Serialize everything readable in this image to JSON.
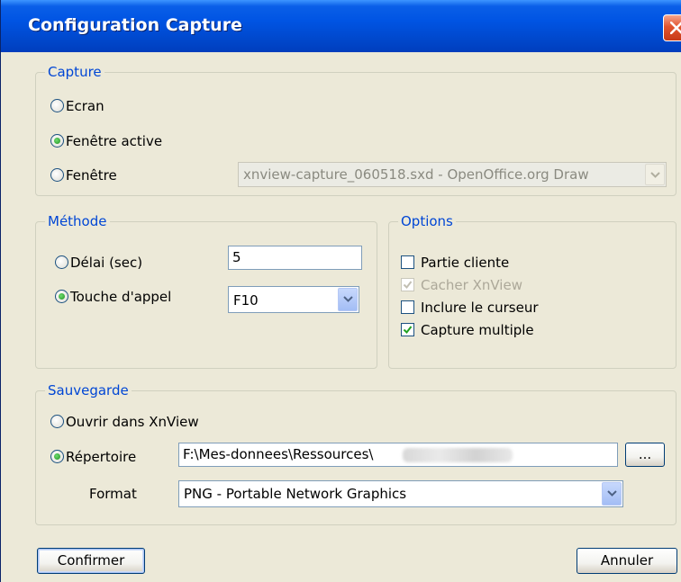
{
  "window": {
    "title": "Configuration Capture"
  },
  "capture": {
    "title": "Capture",
    "options": [
      {
        "label": "Ecran",
        "checked": false
      },
      {
        "label": "Fenêtre active",
        "checked": true
      },
      {
        "label": "Fenêtre",
        "checked": false
      }
    ],
    "window_select": {
      "value": "xnview-capture_060518.sxd - OpenOffice.org Draw",
      "disabled": true
    }
  },
  "methode": {
    "title": "Méthode",
    "delay": {
      "label": "Délai (sec)",
      "checked": false,
      "value": "5"
    },
    "hotkey": {
      "label": "Touche d'appel",
      "checked": true,
      "value": "F10"
    }
  },
  "options": {
    "title": "Options",
    "items": [
      {
        "label": "Partie cliente",
        "checked": false,
        "disabled": false
      },
      {
        "label": "Cacher XnView",
        "checked": true,
        "disabled": true
      },
      {
        "label": "Inclure le curseur",
        "checked": false,
        "disabled": false
      },
      {
        "label": "Capture multiple",
        "checked": true,
        "disabled": false
      }
    ]
  },
  "sauvegarde": {
    "title": "Sauvegarde",
    "open_in": {
      "label": "Ouvrir dans XnView",
      "checked": false
    },
    "directory": {
      "label": "Répertoire",
      "checked": true,
      "value": "F:\\Mes-donnees\\Ressources\\",
      "browse_label": "..."
    },
    "format": {
      "label": "Format",
      "value": "PNG - Portable Network Graphics"
    }
  },
  "buttons": {
    "confirm": "Confirmer",
    "cancel": "Annuler"
  },
  "colors": {
    "group_title": "#0046d5",
    "dialog_bg": "#ece9d8",
    "titlebar": "#0054e3"
  }
}
